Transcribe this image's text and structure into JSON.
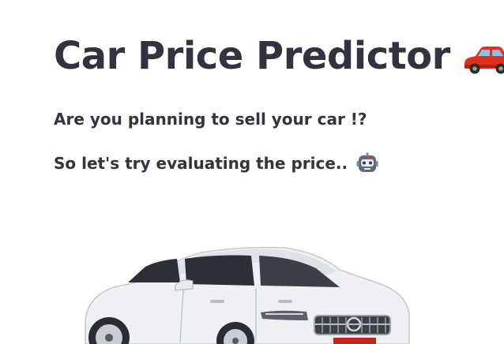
{
  "main": {
    "title": "Car Price Predictor",
    "title_icon": "red-car-icon",
    "subtitle_1": "Are you planning to sell your car !?",
    "subtitle_2": "So let's try evaluating the price..",
    "subtitle_icon": "robot-face-icon",
    "car_image": "silver-sedan-car-image"
  },
  "colors": {
    "text": "#31333f",
    "background": "#ffffff",
    "car_red": "#e0301e",
    "car_body": "#eef0f3"
  }
}
